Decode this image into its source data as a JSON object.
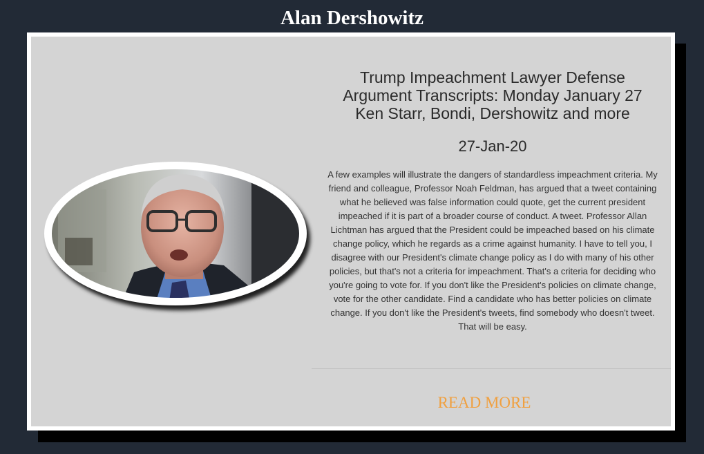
{
  "page": {
    "title": "Alan Dershowitz"
  },
  "article": {
    "headline": "Trump Impeachment Lawyer Defense Argument Transcripts: Monday January 27 Ken Starr, Bondi, Dershowitz and more",
    "date": "27-Jan-20",
    "excerpt": "A few examples will illustrate the dangers of standardless impeachment criteria. My friend and colleague, Professor Noah Feldman, has argued that a tweet containing what he believed was false information could quote, get the current president impeached if it is part of a broader course of conduct. A tweet. Professor Allan Lichtman has argued that the President could be impeached based on his climate change policy, which he regards as a crime against humanity. I have to tell you, I disagree with our President's climate change policy as I do with many of his other policies, but that's not a criteria for impeachment. That's a criteria for deciding who you're going to vote for. If you don't like the President's policies on climate change, vote for the other candidate. Find a candidate who has better policies on climate change. If you don't like the President's tweets, find somebody who doesn't tweet. That will be easy.",
    "read_more_label": "READ MORE"
  },
  "colors": {
    "background": "#222a36",
    "card": "#d4d4d4",
    "accent": "#f0a040"
  }
}
